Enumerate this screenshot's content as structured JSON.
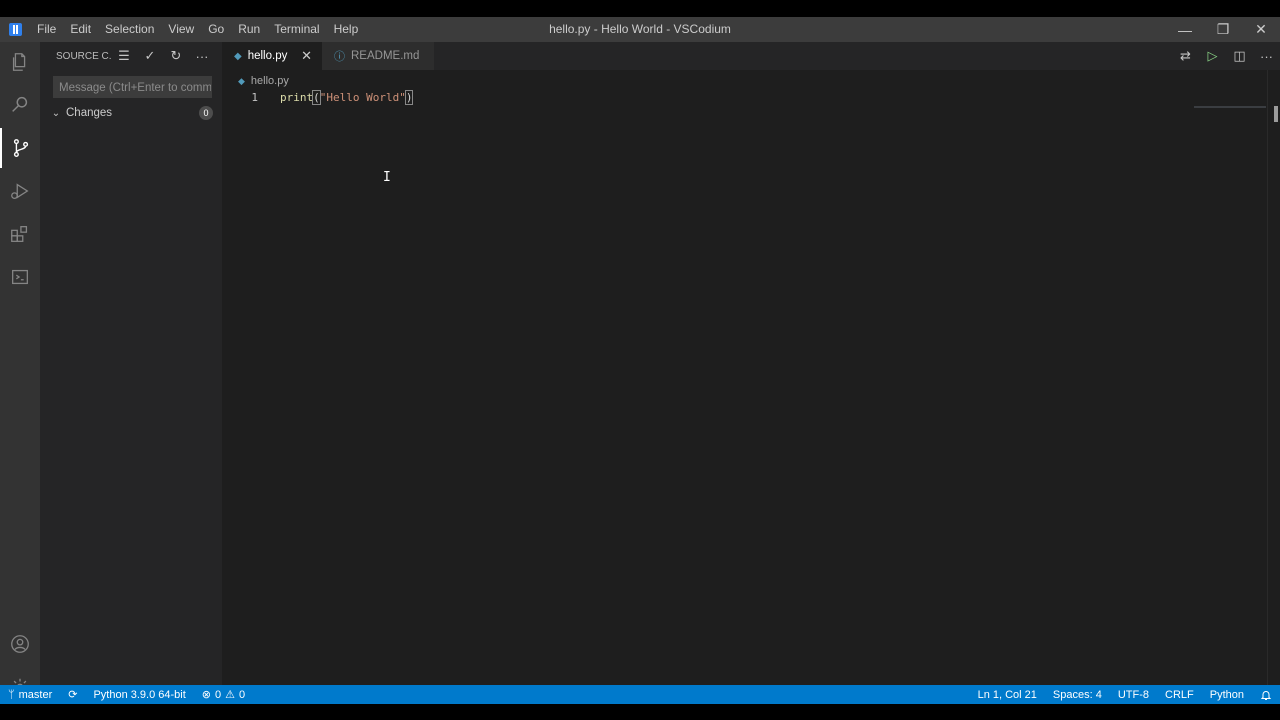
{
  "window": {
    "title": "hello.py - Hello World - VSCodium",
    "controls": {
      "minimize": "—",
      "restore": "❐",
      "close": "✕"
    }
  },
  "menu": [
    "File",
    "Edit",
    "Selection",
    "View",
    "Go",
    "Run",
    "Terminal",
    "Help"
  ],
  "activitybar": {
    "items": [
      "explorer-icon",
      "search-icon",
      "source-control-icon",
      "run-debug-icon",
      "extensions-icon",
      "remote-explorer-icon"
    ],
    "active": "source-control-icon",
    "bottom": [
      "account-icon",
      "manage-gear-icon"
    ]
  },
  "sidebar": {
    "title": "SOURCE C...",
    "actions": {
      "view_as_tree": "☰",
      "commit": "✓",
      "refresh": "↻",
      "more": "···"
    },
    "commit_placeholder": "Message (Ctrl+Enter to comm...",
    "changes_label": "Changes",
    "changes_count": "0"
  },
  "tabs": [
    {
      "label": "hello.py",
      "active": true,
      "close": "✕"
    },
    {
      "label": "README.md",
      "active": false
    }
  ],
  "editor_actions": {
    "open_changes": "⇄",
    "run": "▷",
    "split": "◫",
    "more": "···"
  },
  "breadcrumb": {
    "file": "hello.py"
  },
  "code": {
    "lines": [
      {
        "number": "1",
        "fn": "print",
        "open": "(",
        "str": "\"Hello World\"",
        "close": ")"
      }
    ]
  },
  "statusbar": {
    "branch": "master",
    "sync": "⟳",
    "interpreter": "Python 3.9.0 64-bit",
    "errors": "0",
    "warnings": "0",
    "position": "Ln 1, Col 21",
    "spaces": "Spaces: 4",
    "encoding": "UTF-8",
    "eol": "CRLF",
    "language": "Python",
    "notifications_icon": "bell-icon"
  },
  "colors": {
    "statusbar": "#007acc",
    "titlebar": "#3c3c3c",
    "activitybar": "#333333",
    "sidebar": "#252526",
    "editor": "#1e1e1e"
  }
}
